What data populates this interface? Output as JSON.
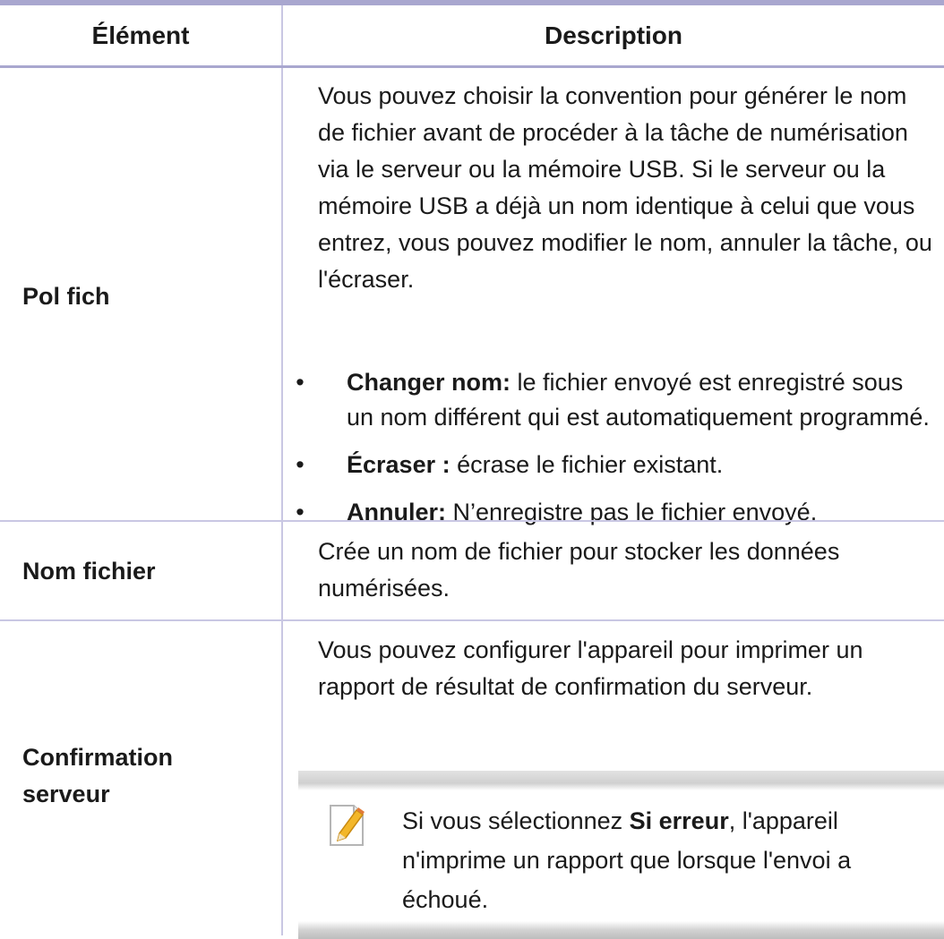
{
  "table": {
    "headers": {
      "element": "Élément",
      "description": "Description"
    },
    "rows": [
      {
        "element": "Pol fich",
        "paragraph": "Vous pouvez choisir la convention pour générer le nom de fichier avant de procéder à la tâche de numérisation via le serveur ou la mémoire USB. Si le serveur ou la mémoire USB a déjà un nom identique à celui que vous entrez, vous pouvez modifier le nom, annuler la tâche, ou l'écraser.",
        "bullets": [
          {
            "bold": "Changer nom:",
            "text": " le fichier envoyé est enregistré sous un nom différent qui est automatiquement programmé."
          },
          {
            "bold": "Écraser :",
            "text": " écrase le fichier existant."
          },
          {
            "bold": "Annuler:",
            "text": " N’enregistre pas le fichier envoyé."
          }
        ]
      },
      {
        "element": "Nom fichier",
        "paragraph": "Crée un nom de fichier pour stocker les données numérisées."
      },
      {
        "element_line1": "Confirmation",
        "element_line2": "serveur",
        "paragraph": "Vous pouvez configurer l'appareil pour imprimer un rapport de résultat de confirmation du serveur.",
        "note": {
          "icon": "note-pencil-icon",
          "prefix": "Si vous sélectionnez ",
          "bold": "Si erreur",
          "suffix": ", l'appareil n'imprime un rapport que lorsque l'envoi a échoué."
        }
      }
    ]
  }
}
